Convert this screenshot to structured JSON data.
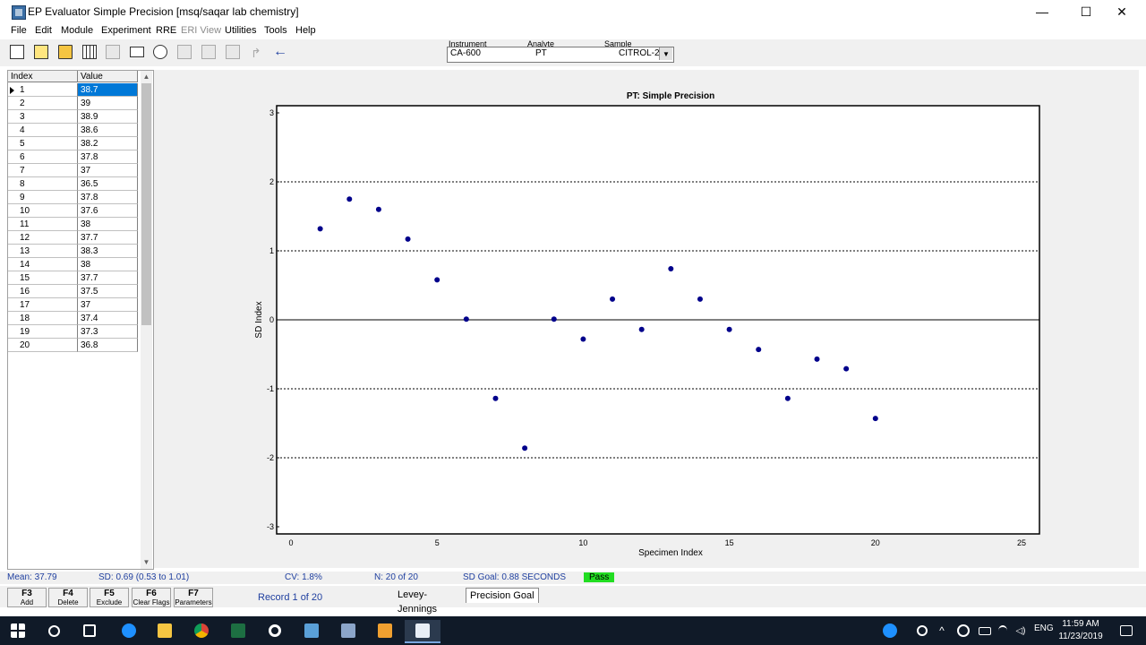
{
  "window": {
    "title": "EP Evaluator Simple Precision  [msq/saqar lab chemistry]",
    "minimize": "—",
    "maximize": "☐",
    "close": "✕"
  },
  "menu": [
    "File",
    "Edit",
    "Module",
    "Experiment",
    "RRE",
    "ERI View",
    "Utilities",
    "Tools",
    "Help"
  ],
  "selector": {
    "instrument_label": "Instrument",
    "analyte_label": "Analyte",
    "sample_label": "Sample",
    "instrument": "CA-600",
    "analyte": "PT",
    "sample": "CITROL-2"
  },
  "grid": {
    "col_index": "Index",
    "col_value": "Value",
    "rows": [
      {
        "i": "1",
        "v": "38.7"
      },
      {
        "i": "2",
        "v": "39"
      },
      {
        "i": "3",
        "v": "38.9"
      },
      {
        "i": "4",
        "v": "38.6"
      },
      {
        "i": "5",
        "v": "38.2"
      },
      {
        "i": "6",
        "v": "37.8"
      },
      {
        "i": "7",
        "v": "37"
      },
      {
        "i": "8",
        "v": "36.5"
      },
      {
        "i": "9",
        "v": "37.8"
      },
      {
        "i": "10",
        "v": "37.6"
      },
      {
        "i": "11",
        "v": "38"
      },
      {
        "i": "12",
        "v": "37.7"
      },
      {
        "i": "13",
        "v": "38.3"
      },
      {
        "i": "14",
        "v": "38"
      },
      {
        "i": "15",
        "v": "37.7"
      },
      {
        "i": "16",
        "v": "37.5"
      },
      {
        "i": "17",
        "v": "37"
      },
      {
        "i": "18",
        "v": "37.4"
      },
      {
        "i": "19",
        "v": "37.3"
      },
      {
        "i": "20",
        "v": "36.8"
      }
    ]
  },
  "chart_data": {
    "type": "scatter",
    "title": "PT: Simple Precision",
    "xlabel": "Specimen Index",
    "ylabel": "SD Index",
    "xlim": [
      0,
      25
    ],
    "ylim": [
      -3,
      3
    ],
    "xticks": [
      "0",
      "5",
      "10",
      "15",
      "20",
      "25"
    ],
    "yticks": [
      "3",
      "2",
      "1",
      "0",
      "-1",
      "-2",
      "-3"
    ],
    "dashed_lines": [
      2,
      1,
      -1,
      -2
    ],
    "solid_lines": [
      0
    ],
    "grid": false,
    "series": [
      {
        "values": [
          [
            1,
            1.32
          ],
          [
            2,
            1.75
          ],
          [
            3,
            1.6
          ],
          [
            4,
            1.17
          ],
          [
            5,
            0.58
          ],
          [
            6,
            0.01
          ],
          [
            7,
            -1.14
          ],
          [
            8,
            -1.86
          ],
          [
            9,
            0.01
          ],
          [
            10,
            -0.28
          ],
          [
            11,
            0.3
          ],
          [
            12,
            -0.14
          ],
          [
            13,
            0.74
          ],
          [
            14,
            0.3
          ],
          [
            15,
            -0.14
          ],
          [
            16,
            -0.43
          ],
          [
            17,
            -1.14
          ],
          [
            18,
            -0.57
          ],
          [
            19,
            -0.71
          ],
          [
            20,
            -1.43
          ]
        ],
        "color": "#00008b"
      }
    ]
  },
  "status": {
    "mean": "Mean: 37.79",
    "sd": "SD: 0.69  (0.53 to 1.01)",
    "cv": "CV: 1.8%",
    "n": "N: 20 of 20",
    "sd_goal": "SD Goal: 0.88 SECONDS",
    "result": "Pass"
  },
  "fkeys": [
    {
      "k": "F3",
      "l": "Add"
    },
    {
      "k": "F4",
      "l": "Delete"
    },
    {
      "k": "F5",
      "l": "Exclude"
    },
    {
      "k": "F6",
      "l": "Clear Flags"
    },
    {
      "k": "F7",
      "l": "Parameters"
    }
  ],
  "record": "Record 1 of 20",
  "tabs": [
    "Levey-Jennings",
    "Precision Goal"
  ],
  "taskbar": {
    "lang": "ENG",
    "time": "11:59 AM",
    "date": "11/23/2019"
  },
  "colors": {
    "accent": "#0078d7",
    "pass": "#22dd22",
    "taskbar": "#101a28",
    "point": "#00008b"
  }
}
